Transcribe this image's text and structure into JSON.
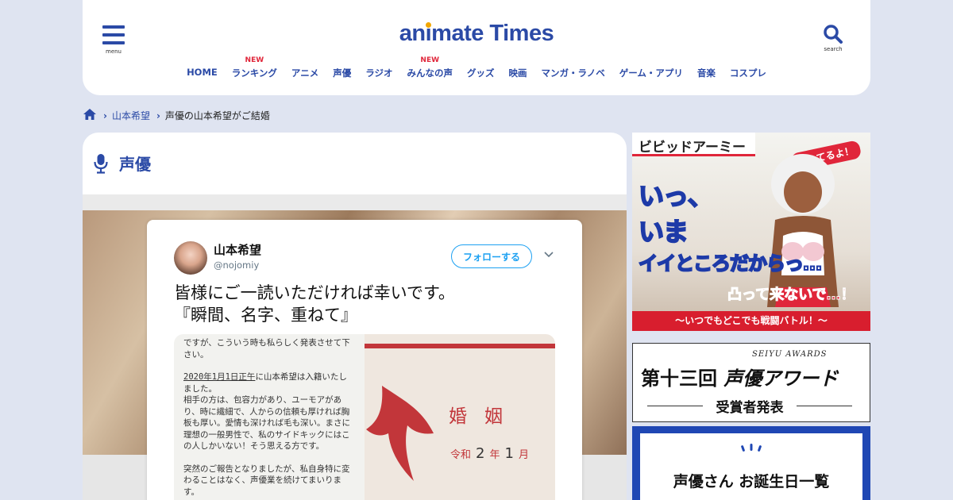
{
  "header": {
    "logo": "animate Times",
    "logo_pre": "an",
    "logo_i": "i",
    "logo_post": "mate Times",
    "menu_label": "menu",
    "search_label": "search",
    "nav": [
      {
        "label": "HOME",
        "badge": ""
      },
      {
        "label": "ランキング",
        "badge": "NEW"
      },
      {
        "label": "アニメ",
        "badge": ""
      },
      {
        "label": "声優",
        "badge": ""
      },
      {
        "label": "ラジオ",
        "badge": ""
      },
      {
        "label": "みんなの声",
        "badge": "NEW"
      },
      {
        "label": "グッズ",
        "badge": ""
      },
      {
        "label": "映画",
        "badge": ""
      },
      {
        "label": "マンガ・ラノベ",
        "badge": ""
      },
      {
        "label": "ゲーム・アプリ",
        "badge": ""
      },
      {
        "label": "音楽",
        "badge": ""
      },
      {
        "label": "コスプレ",
        "badge": ""
      }
    ]
  },
  "breadcrumb": {
    "items": [
      "山本希望",
      "声優の山本希望がご結婚"
    ]
  },
  "article": {
    "category": "声優"
  },
  "tweet": {
    "name": "山本希望",
    "handle": "@nojomiy",
    "follow_label": "フォローする",
    "text_line1": "皆様にご一読いただければ幸いです。",
    "text_line2": "『瞬間、名字、重ねて』",
    "note_p1": "ですが、こういう時も私らしく発表させて下さい。",
    "note_p2_pre": "",
    "note_p2_date": "2020年1月1日正午",
    "note_p2_post": "に山本希望は入籍いたしました。",
    "note_p3": "相手の方は、包容力があり、ユーモアがあり、時に繊細で、人からの信頼も厚ければ胸板も厚い。愛情も深ければ毛も深い。まさに理想の一般男性で、私のサイドキックにはこの人しかいない！そう思える方です。",
    "note_p4": "突然のご報告となりましたが、私自身特に変わることはなく、声優業を続けてまいります。",
    "paper_title": "婚姻",
    "paper_era": "令和",
    "paper_year": "2",
    "paper_year_unit": "年",
    "paper_month": "1",
    "paper_month_unit": "月"
  },
  "ads": {
    "ad1_title": "ビビッドアーミー",
    "ad1_tag": "切れてるよ！",
    "ad1_line1": "いっ、",
    "ad1_line2": "いま",
    "ad1_line3": "イイところだからっ…",
    "ad1_cta": "凸って来ないで…！",
    "ad1_foot": "〜いつでもどこでも戦闘バトル！〜",
    "ad2_sub": "SEIYU AWARDS",
    "ad2_main_pre": "第十三回 ",
    "ad2_main_it": "声優アワード",
    "ad2_foot": "受賞者発表",
    "ad3_text": "声優さん お誕生日一覧"
  },
  "colors": {
    "brand": "#2b4aa6",
    "new_badge": "#e0263a",
    "twitter": "#1da1f2",
    "background": "#dfe4f1"
  },
  "icons": [
    "menu-icon",
    "search-icon",
    "home-icon",
    "microphone-icon",
    "chevron-down-icon"
  ]
}
